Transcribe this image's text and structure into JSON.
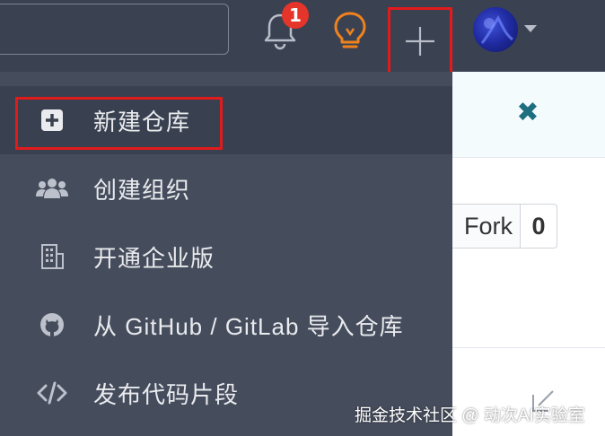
{
  "header": {
    "notification_count": "1",
    "icons": [
      "bell-icon",
      "lightbulb-icon",
      "plus-icon",
      "avatar",
      "chevron-down-icon"
    ]
  },
  "dropdown": {
    "items": [
      {
        "label": "新建仓库",
        "icon": "plus-square-icon",
        "active": true
      },
      {
        "label": "创建组织",
        "icon": "users-icon",
        "active": false
      },
      {
        "label": "开通企业版",
        "icon": "building-icon",
        "active": false
      },
      {
        "label": "从 GitHub / GitLab 导入仓库",
        "icon": "github-icon",
        "active": false
      },
      {
        "label": "发布代码片段",
        "icon": "code-icon",
        "active": false
      }
    ]
  },
  "repo": {
    "fork_label": "Fork",
    "fork_count": "0"
  },
  "watermark": "掘金技术社区 @ 动次AI实验室",
  "colors": {
    "topbar": "#3a4252",
    "dropdown": "#454c5c",
    "dropdown_active": "#39404f",
    "highlight": "#e11b1b",
    "badge": "#e5342a",
    "bulb": "#f0821e",
    "close": "#1d6f7f"
  }
}
